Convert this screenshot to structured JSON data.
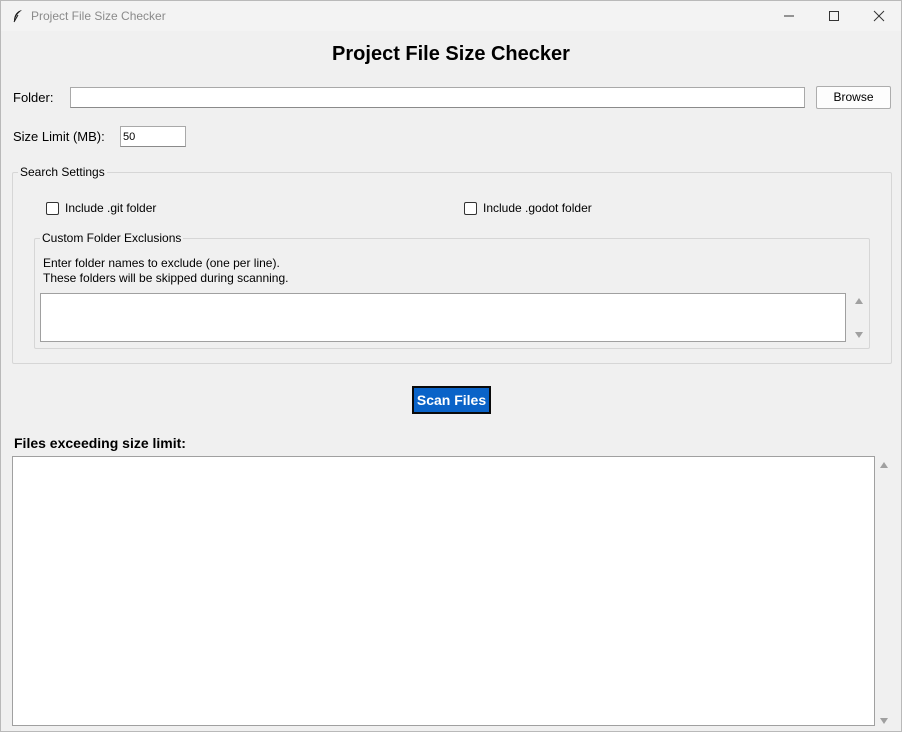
{
  "window": {
    "title": "Project File Size Checker"
  },
  "heading": "Project File Size Checker",
  "folder": {
    "label": "Folder:",
    "value": "",
    "browse_label": "Browse"
  },
  "size_limit": {
    "label": "Size Limit (MB):",
    "value": "50"
  },
  "search_settings": {
    "title": "Search Settings",
    "include_git": {
      "label": "Include .git folder",
      "checked": false
    },
    "include_godot": {
      "label": "Include .godot folder",
      "checked": false
    },
    "exclusions": {
      "title": "Custom Folder Exclusions",
      "help_line1": "Enter folder names to exclude (one per line).",
      "help_line2": "These folders will be skipped during scanning.",
      "value": ""
    }
  },
  "scan_button_label": "Scan Files",
  "results": {
    "label": "Files exceeding size limit:",
    "content": ""
  },
  "icons": {
    "app": "feather-icon",
    "minimize": "minimize-icon",
    "maximize": "maximize-icon",
    "close": "close-icon"
  },
  "colors": {
    "accent": "#0a63c8",
    "background": "#f0f0f0"
  }
}
